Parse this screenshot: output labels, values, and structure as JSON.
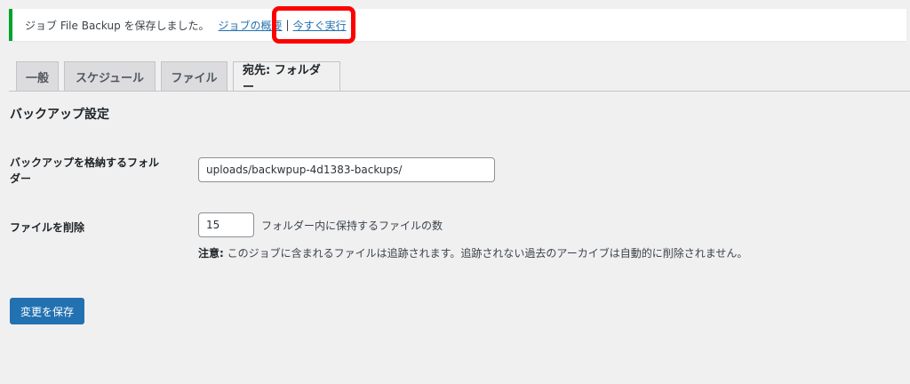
{
  "notice": {
    "message": "ジョブ File Backup を保存しました。",
    "link_overview": "ジョブの概要",
    "separator": "|",
    "link_run_now": "今すぐ実行"
  },
  "tabs": [
    {
      "label": "一般"
    },
    {
      "label": "スケジュール"
    },
    {
      "label": "ファイル"
    },
    {
      "label": "宛先: フォルダー",
      "active": true
    }
  ],
  "section": {
    "title": "バックアップ設定"
  },
  "folder": {
    "label_line1": "バックアップを格納するフォル",
    "label_line2": "ダー",
    "value": "uploads/backwpup-4d1383-backups/"
  },
  "delete_files": {
    "label": "ファイルを削除",
    "value": "15",
    "description": "フォルダー内に保持するファイルの数",
    "note_prefix": "注意:",
    "note_text": " このジョブに含まれるファイルは追跡されます。追跡されない過去のアーカイブは自動的に削除されません。"
  },
  "save_button": {
    "label": "変更を保存"
  },
  "colors": {
    "accent": "#2271b1",
    "notice_success": "#00a32a",
    "highlight": "#ff0000"
  }
}
